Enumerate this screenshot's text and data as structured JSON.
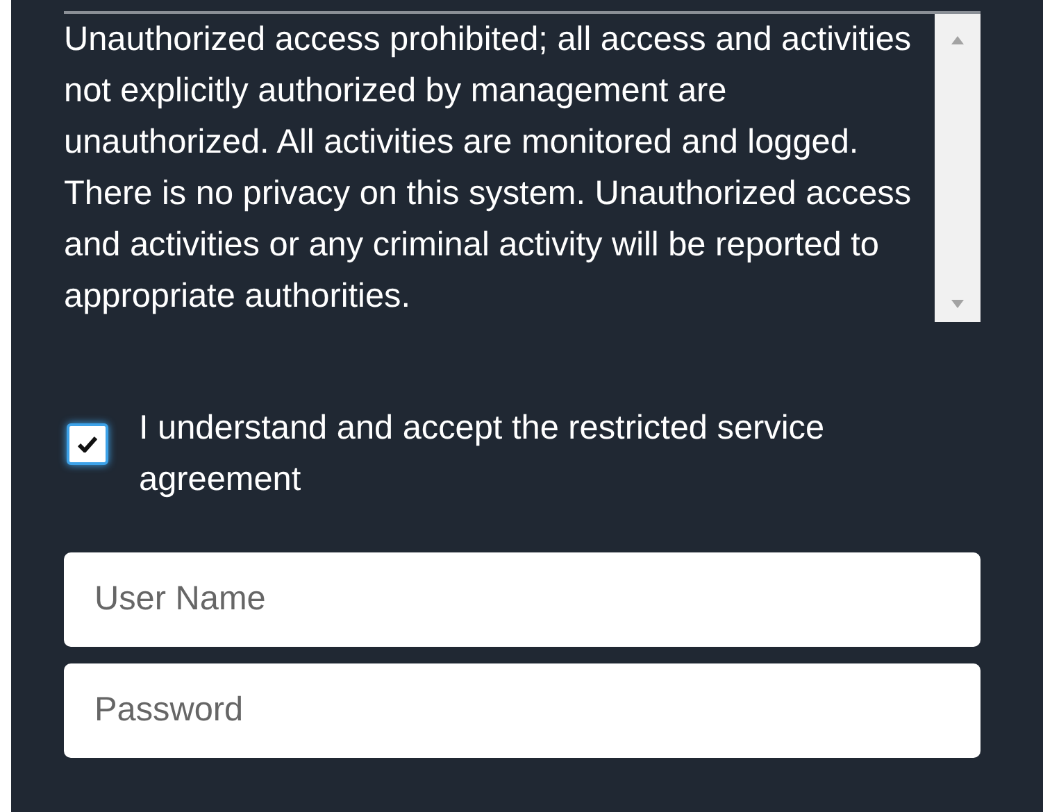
{
  "notice": {
    "text": "Unauthorized access prohibited; all access and activities not explicitly authorized by management are unauthorized. All activities are monitored and logged. There is no privacy on this system. Unauthorized access and activities or any criminal activity will be reported to appropriate authorities."
  },
  "agreement": {
    "label": "I understand and accept the restricted service agreement",
    "checked": true
  },
  "fields": [
    {
      "placeholder": "User Name"
    },
    {
      "placeholder": "Password"
    }
  ]
}
